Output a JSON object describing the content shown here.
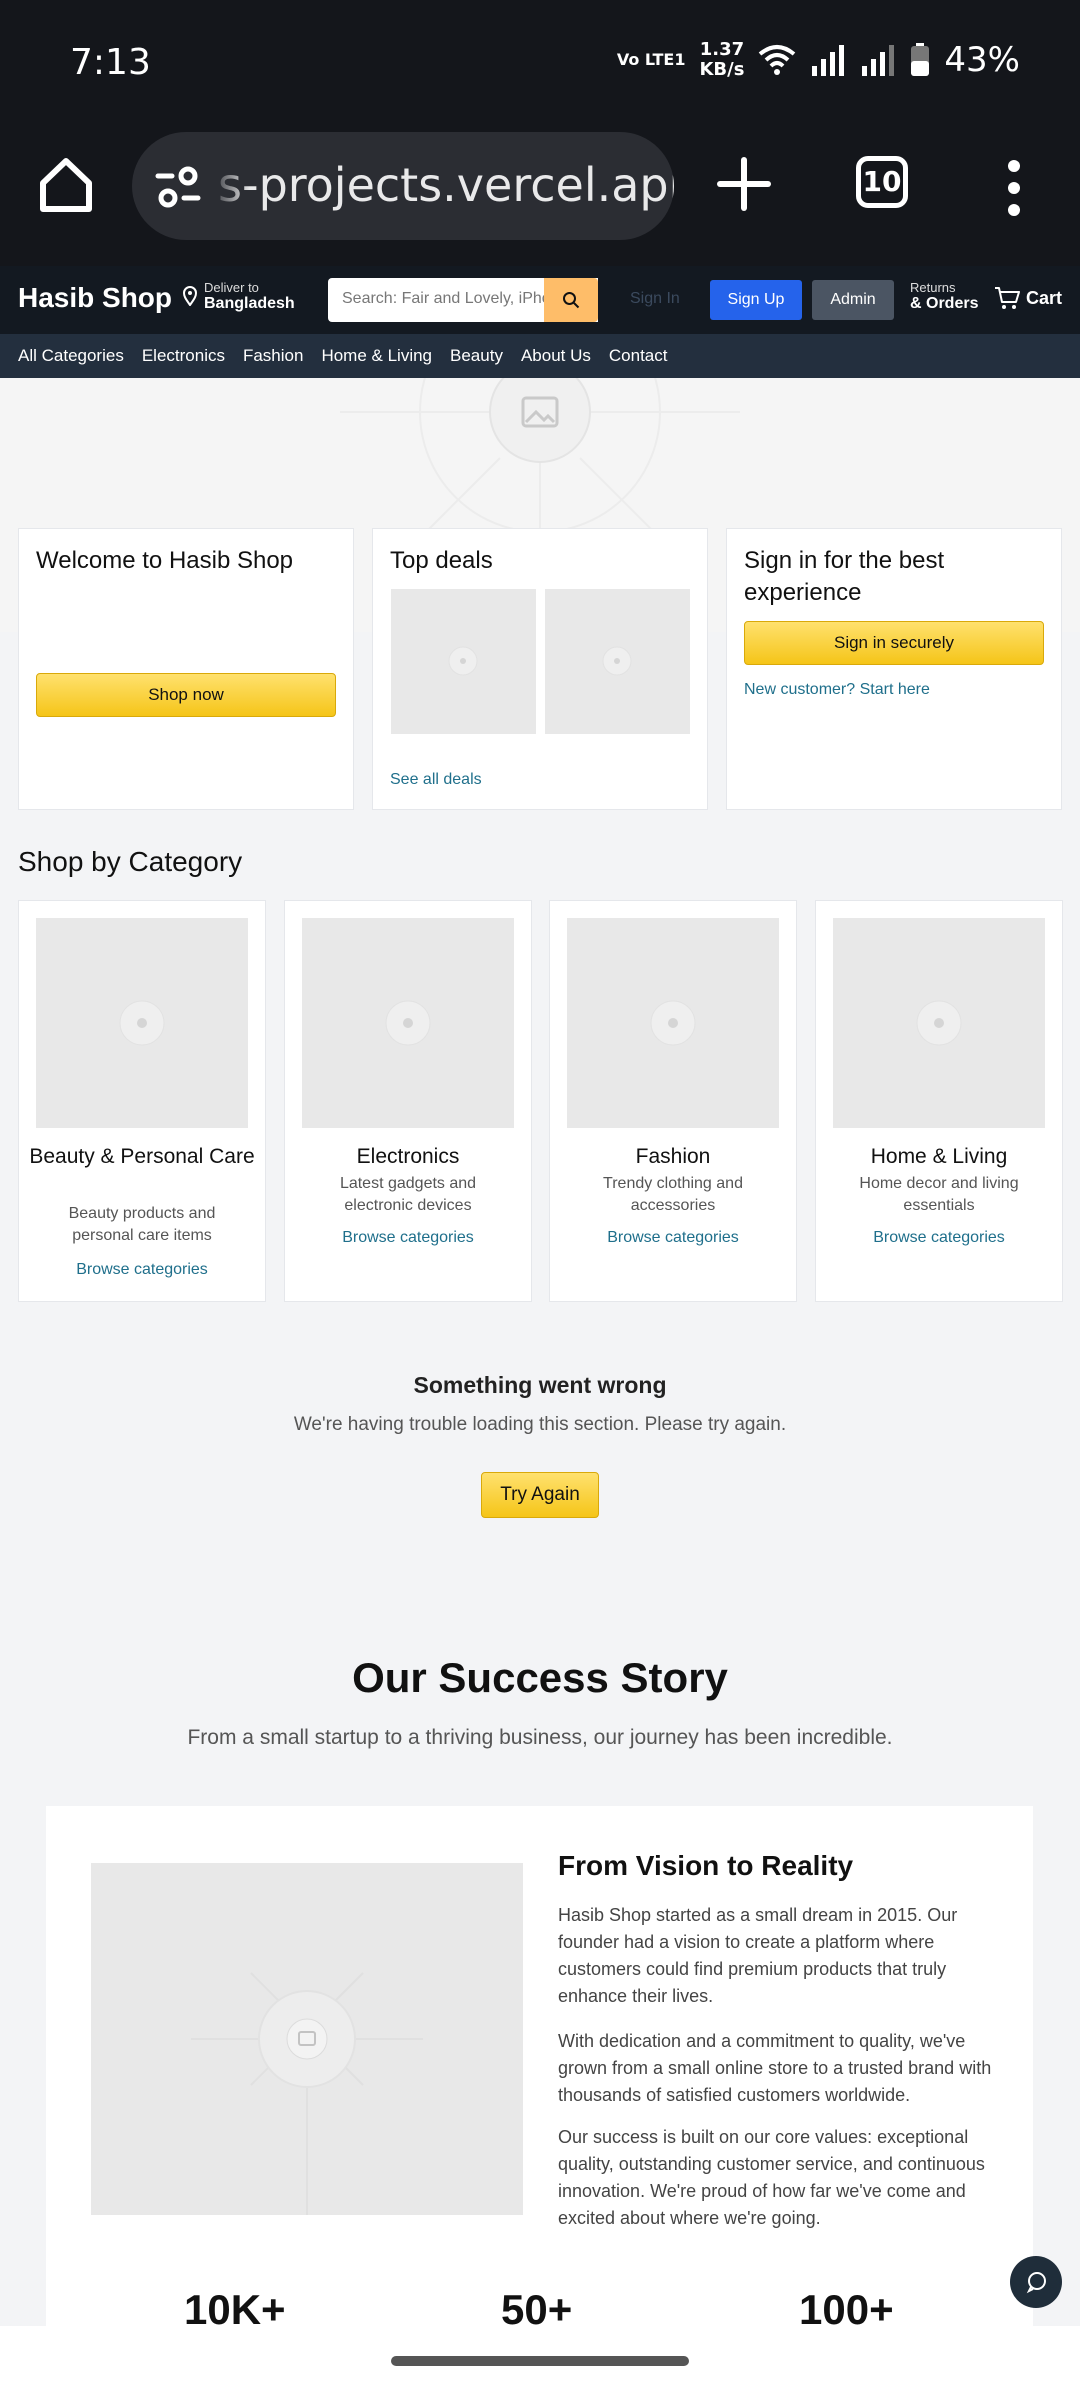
{
  "status_bar": {
    "time": "7:13",
    "volte": "Vo LTE1",
    "speed": "1.37",
    "speed_unit": "KB/s",
    "battery": "43%"
  },
  "browser": {
    "url": "s-projects.vercel.app",
    "tab_count": "10"
  },
  "header": {
    "logo": "Hasib Shop",
    "deliver_small": "Deliver to",
    "deliver_big": "Bangladesh",
    "search_placeholder": "Search: Fair and Lovely, iPhone...",
    "signin": "Sign In",
    "signup": "Sign Up",
    "admin": "Admin",
    "returns_small": "Returns",
    "returns_big": "& Orders",
    "cart": "Cart"
  },
  "nav": [
    "All Categories",
    "Electronics",
    "Fashion",
    "Home & Living",
    "Beauty",
    "About Us",
    "Contact"
  ],
  "cards": {
    "welcome_title": "Welcome to Hasib Shop",
    "shop_now": "Shop now",
    "deals_title": "Top deals",
    "see_all": "See all deals",
    "signin_title": "Sign in for the best experience",
    "signin_btn": "Sign in securely",
    "new_customer": "New customer? Start here"
  },
  "categories_title": "Shop by Category",
  "categories": [
    {
      "name": "Beauty & Personal Care",
      "desc": "Beauty products and personal care items",
      "link": "Browse categories"
    },
    {
      "name": "Electronics",
      "desc": "Latest gadgets and electronic devices",
      "link": "Browse categories"
    },
    {
      "name": "Fashion",
      "desc": "Trendy clothing and accessories",
      "link": "Browse categories"
    },
    {
      "name": "Home & Living",
      "desc": "Home decor and living essentials",
      "link": "Browse categories"
    }
  ],
  "error": {
    "title": "Something went wrong",
    "text": "We're having trouble loading this section. Please try again.",
    "button": "Try Again"
  },
  "story": {
    "title": "Our Success Story",
    "subtitle": "From a small startup to a thriving business, our journey has been incredible.",
    "heading": "From Vision to Reality",
    "p1": "Hasib Shop started as a small dream in 2015. Our founder had a vision to create a platform where customers could find premium products that truly enhance their lives.",
    "p2": "With dedication and a commitment to quality, we've grown from a small online store to a trusted brand with thousands of satisfied customers worldwide.",
    "p3": "Our success is built on our core values: exceptional quality, outstanding customer service, and continuous innovation. We're proud of how far we've come and excited about where we're going.",
    "stats": [
      "10K+",
      "50+",
      "100+"
    ]
  },
  "icons": {
    "home": "home-icon",
    "tune": "tune-icon",
    "plus": "plus-icon",
    "menu": "more-vert-icon",
    "location": "location-pin-icon",
    "search": "search-icon",
    "cart": "cart-icon",
    "chat": "chat-icon"
  }
}
